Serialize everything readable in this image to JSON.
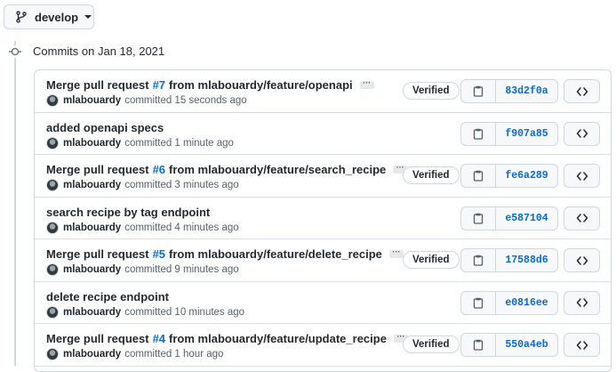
{
  "branch": {
    "name": "develop",
    "icon": "git-branch-icon"
  },
  "group": {
    "title": "Commits on Jan 18, 2021"
  },
  "commits": [
    {
      "title_before": "Merge pull request",
      "pr_link": "#7",
      "title_after": "from mlabouardy/feature/openapi",
      "has_ellipsis": true,
      "author": "mlabouardy",
      "time_text": "committed 15 seconds ago",
      "verified": "Verified",
      "sha": "83d2f0a"
    },
    {
      "title_before": "added openapi specs",
      "pr_link": "",
      "title_after": "",
      "has_ellipsis": false,
      "author": "mlabouardy",
      "time_text": "committed 1 minute ago",
      "verified": "",
      "sha": "f907a85"
    },
    {
      "title_before": "Merge pull request",
      "pr_link": "#6",
      "title_after": "from mlabouardy/feature/search_recipe",
      "has_ellipsis": true,
      "author": "mlabouardy",
      "time_text": "committed 3 minutes ago",
      "verified": "Verified",
      "sha": "fe6a289"
    },
    {
      "title_before": "search recipe by tag endpoint",
      "pr_link": "",
      "title_after": "",
      "has_ellipsis": false,
      "author": "mlabouardy",
      "time_text": "committed 4 minutes ago",
      "verified": "",
      "sha": "e587104"
    },
    {
      "title_before": "Merge pull request",
      "pr_link": "#5",
      "title_after": "from mlabouardy/feature/delete_recipe",
      "has_ellipsis": true,
      "author": "mlabouardy",
      "time_text": "committed 9 minutes ago",
      "verified": "Verified",
      "sha": "17588d6"
    },
    {
      "title_before": "delete recipe endpoint",
      "pr_link": "",
      "title_after": "",
      "has_ellipsis": false,
      "author": "mlabouardy",
      "time_text": "committed 10 minutes ago",
      "verified": "",
      "sha": "e0816ee"
    },
    {
      "title_before": "Merge pull request",
      "pr_link": "#4",
      "title_after": "from mlabouardy/feature/update_recipe",
      "has_ellipsis": true,
      "author": "mlabouardy",
      "time_text": "committed 1 hour ago",
      "verified": "Verified",
      "sha": "550a4eb"
    }
  ],
  "ellipsis_text": "···",
  "icons": {
    "copy": "clipboard-icon",
    "browse": "code-icon",
    "timeline": "git-commit-icon"
  },
  "colors": {
    "link": "#0969da",
    "border": "#d0d7de",
    "text": "#24292f",
    "muted": "#57606a"
  }
}
